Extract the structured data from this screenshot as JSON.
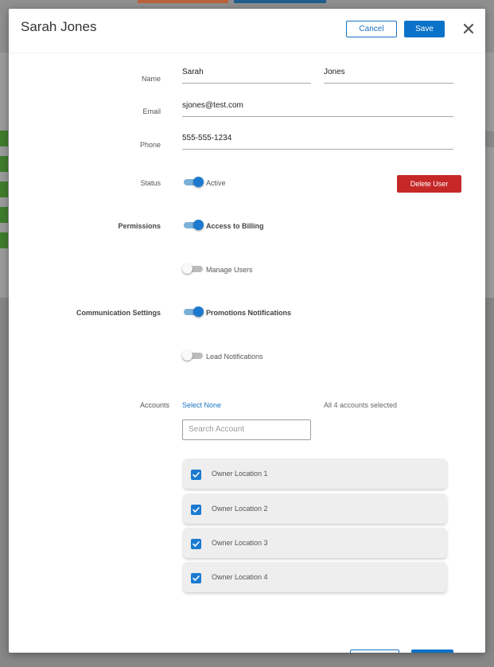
{
  "modal": {
    "title": "Sarah Jones",
    "cancel_label": "Cancel",
    "save_label": "Save"
  },
  "form": {
    "name_label": "Name",
    "first_name": "Sarah",
    "last_name": "Jones",
    "email_label": "Email",
    "email": "sjones@test.com",
    "phone_label": "Phone",
    "phone": "555-555-1234",
    "status_label": "Status",
    "status_toggle_label": "Active",
    "status_on": true,
    "delete_label": "Delete User",
    "permissions_label": "Permissions",
    "permissions": [
      {
        "label": "Access to Billing",
        "on": true
      },
      {
        "label": "Manage Users",
        "on": false
      }
    ],
    "communication_label": "Communication Settings",
    "communications": [
      {
        "label": "Promotions Notifications",
        "on": true
      },
      {
        "label": "Lead Notifications",
        "on": false
      }
    ],
    "accounts_label": "Accounts",
    "select_none_label": "Select None",
    "accounts_selected_text": "All 4 accounts selected",
    "search_placeholder": "Search Account",
    "accounts": [
      {
        "label": "Owner Location 1",
        "checked": true
      },
      {
        "label": "Owner Location 2",
        "checked": true
      },
      {
        "label": "Owner Location 3",
        "checked": true
      },
      {
        "label": "Owner Location 4",
        "checked": true
      }
    ]
  },
  "colors": {
    "primary": "#0a72c9",
    "danger": "#c62828",
    "toggle_on": "#1b7ad0"
  }
}
